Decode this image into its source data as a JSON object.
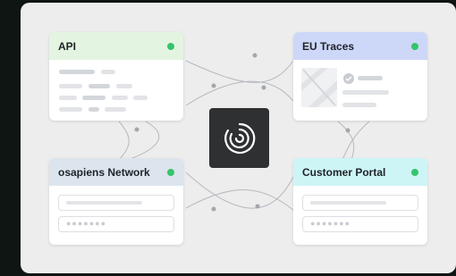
{
  "colors": {
    "status_green": "#35c46b",
    "api_header": "#e3f5e1",
    "eu_header": "#cdd7f8",
    "network_header": "#dce5ee",
    "portal_header": "#cdf5f6"
  },
  "cards": {
    "api": {
      "title": "API"
    },
    "eu_traces": {
      "title": "EU Traces"
    },
    "network": {
      "title": "osapiens Network",
      "password_mask": "●●●●●●●"
    },
    "portal": {
      "title": "Customer Portal",
      "password_mask": "●●●●●●●"
    }
  },
  "hub": {
    "icon": "osapiens-logo-icon"
  }
}
